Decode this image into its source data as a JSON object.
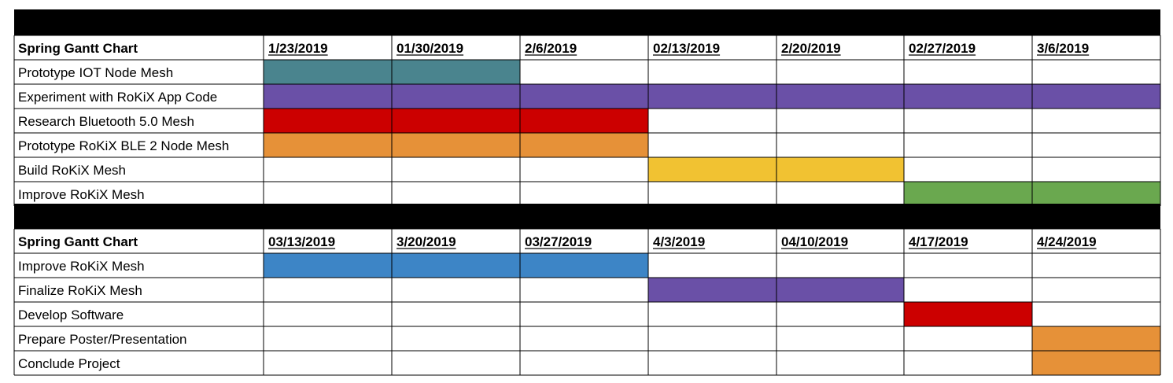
{
  "chart_data": [
    {
      "type": "table",
      "title": "Spring Gantt Chart",
      "columns": [
        "1/23/2019",
        "01/30/2019",
        "2/6/2019",
        "02/13/2019",
        "2/20/2019",
        "02/27/2019",
        "3/6/2019"
      ],
      "tasks": [
        {
          "name": "Prototype IOT Node Mesh",
          "start": 0,
          "end": 1,
          "color": "#4a848e"
        },
        {
          "name": "Experiment with RoKiX App Code",
          "start": 0,
          "end": 6,
          "color": "#6a50a7"
        },
        {
          "name": "Research Bluetooth 5.0 Mesh",
          "start": 0,
          "end": 2,
          "color": "#cc0000"
        },
        {
          "name": "Prototype RoKiX BLE 2 Node Mesh",
          "start": 0,
          "end": 2,
          "color": "#e69138"
        },
        {
          "name": "Build RoKiX Mesh",
          "start": 3,
          "end": 4,
          "color": "#f1c232"
        },
        {
          "name": "Improve RoKiX Mesh",
          "start": 5,
          "end": 6,
          "color": "#6aa84f"
        }
      ]
    },
    {
      "type": "table",
      "title": "Spring Gantt Chart",
      "columns": [
        "03/13/2019",
        "3/20/2019",
        "03/27/2019",
        "4/3/2019",
        "04/10/2019",
        "4/17/2019",
        "4/24/2019"
      ],
      "tasks": [
        {
          "name": "Improve RoKiX Mesh",
          "start": 0,
          "end": 2,
          "color": "#3d85c6"
        },
        {
          "name": "Finalize RoKiX Mesh",
          "start": 3,
          "end": 4,
          "color": "#6a50a7"
        },
        {
          "name": "Develop Software",
          "start": 5,
          "end": 5,
          "color": "#cc0000"
        },
        {
          "name": "Prepare Poster/Presentation",
          "start": 6,
          "end": 6,
          "color": "#e69138"
        },
        {
          "name": "Conclude Project",
          "start": 6,
          "end": 6,
          "color": "#e69138"
        }
      ]
    }
  ]
}
